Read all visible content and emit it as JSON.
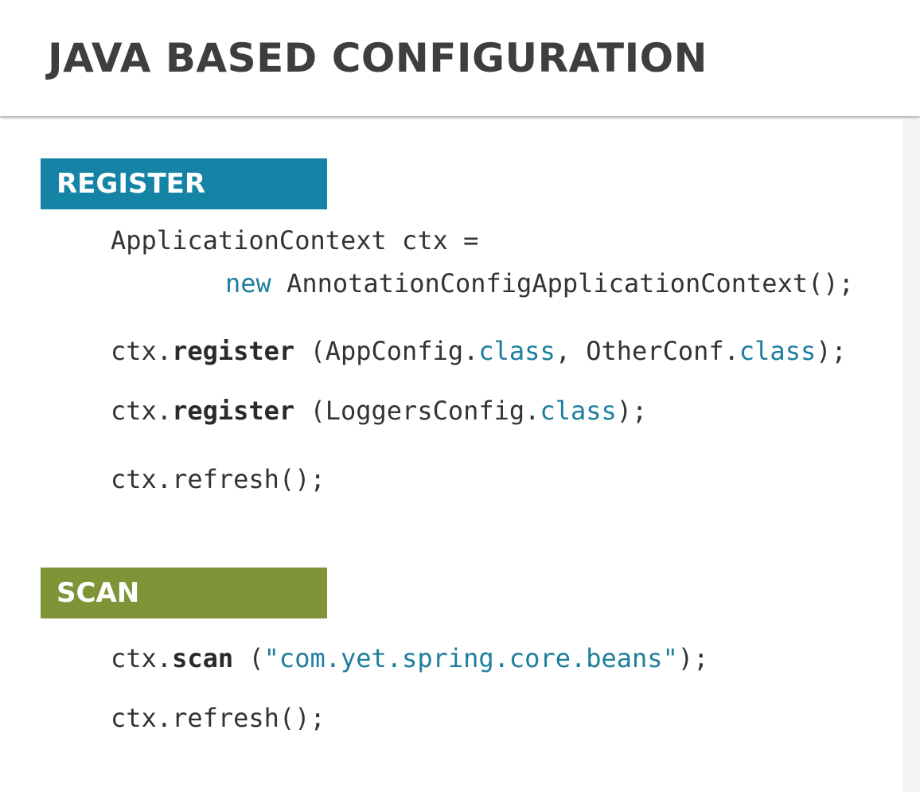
{
  "header": {
    "title": "JAVA BASED CONFIGURATION"
  },
  "sections": {
    "register": {
      "label": "REGISTER",
      "color": "#1583a6",
      "lines": {
        "l1": "ApplicationContext ctx =",
        "l2_kw": "new",
        "l2_rest": " AnnotationConfigApplicationContext();",
        "l3_obj": "ctx.",
        "l3_method": "register",
        "l3_a": " (AppConfig.",
        "l3_kw1": "class",
        "l3_b": ", OtherConf.",
        "l3_kw2": "class",
        "l3_c": ");",
        "l4_obj": "ctx.",
        "l4_method": "register",
        "l4_a": " (LoggersConfig.",
        "l4_kw": "class",
        "l4_b": ");",
        "l5": "ctx.refresh();"
      }
    },
    "scan": {
      "label": "SCAN",
      "color": "#7f9437",
      "lines": {
        "l1_obj": "ctx.",
        "l1_method": "scan",
        "l1_a": " (",
        "l1_str": "\"com.yet.spring.core.beans\"",
        "l1_b": ");",
        "l2": "ctx.refresh();"
      }
    }
  },
  "colors": {
    "keyword": "#1d7f9d",
    "code_text": "#333333",
    "title_text": "#3e3e3e"
  }
}
